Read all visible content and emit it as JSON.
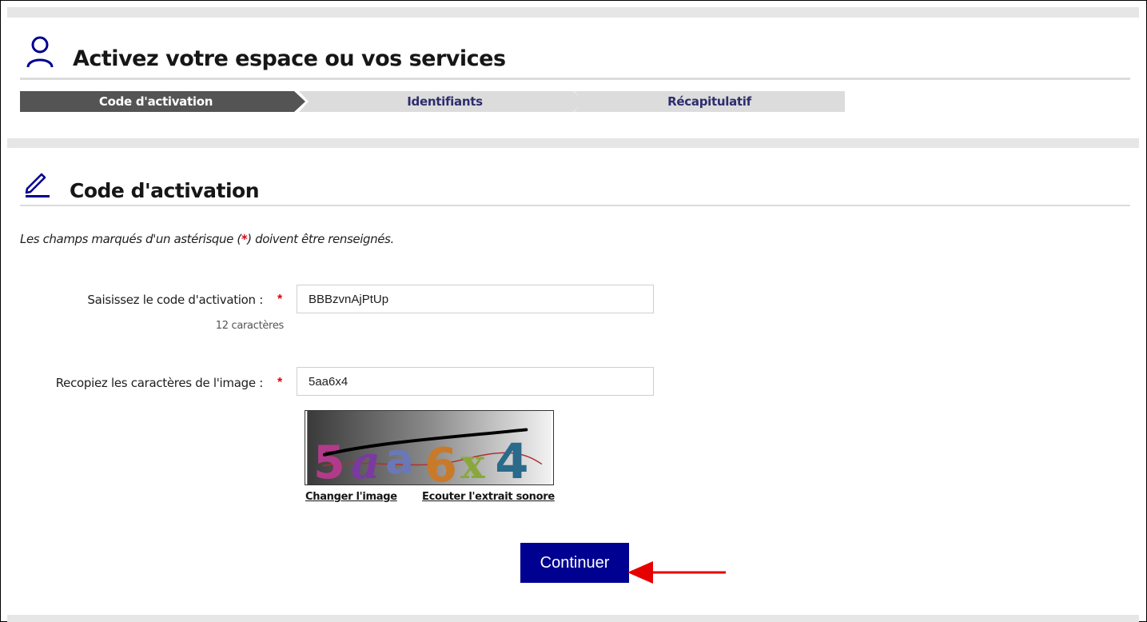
{
  "header": {
    "title": "Activez votre espace ou vos services",
    "icon": "user-icon"
  },
  "stepper": {
    "steps": [
      {
        "label": "Code d'activation",
        "active": true
      },
      {
        "label": "Identifiants",
        "active": false
      },
      {
        "label": "Récapitulatif",
        "active": false
      }
    ]
  },
  "section": {
    "title": "Code d'activation",
    "icon": "pencil-icon"
  },
  "form": {
    "required_note_before": "Les champs marqués d'un astérisque (",
    "required_note_star": "*",
    "required_note_after": ") doivent être renseignés.",
    "activation_code": {
      "label": "Saisissez le code d'activation :",
      "value": "BBBzvnAjPtUp",
      "hint": "12 caractères",
      "required_mark": "*"
    },
    "captcha": {
      "label": "Recopiez les caractères de l'image :",
      "value": "5aa6x4",
      "required_mark": "*",
      "image_text": "5aa6x4",
      "change_link": "Changer l'image",
      "audio_link": "Ecouter l'extrait sonore"
    },
    "submit_label": "Continuer"
  },
  "colors": {
    "primary_blue": "#000091",
    "required_red": "#e1000f",
    "active_step": "#545454",
    "inactive_step": "#dcdcdc",
    "annotation_arrow": "#e60000"
  }
}
